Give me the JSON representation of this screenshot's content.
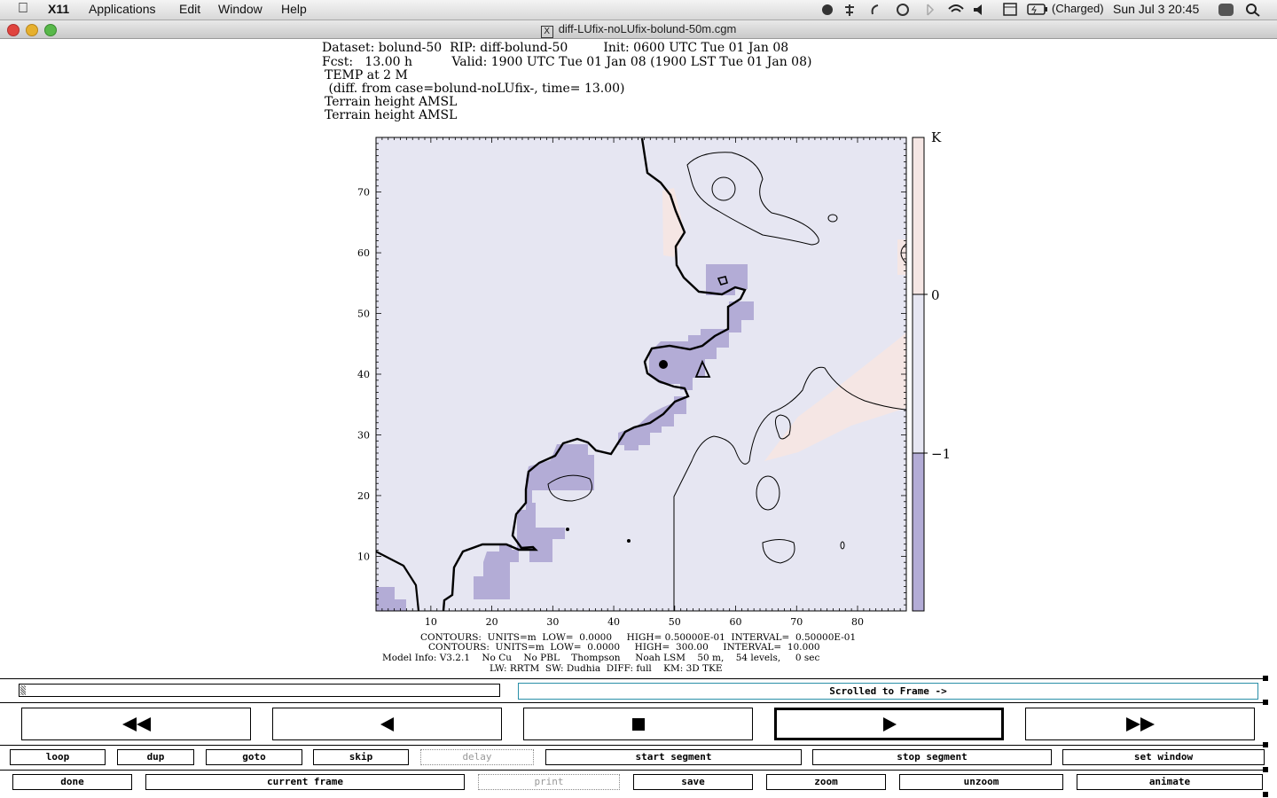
{
  "menubar": {
    "app": "X11",
    "items": [
      "Applications",
      "Edit",
      "Window",
      "Help"
    ],
    "battery": "(Charged)",
    "clock": "Sun Jul 3  20:45"
  },
  "window": {
    "title": "diff-LUfix-noLUfix-bolund-50m.cgm"
  },
  "header": {
    "line1": "Dataset: bolund-50  RIP: diff-bolund-50         Init: 0600 UTC Tue 01 Jan 08",
    "line2": "Fcst:   13.00 h          Valid: 1900 UTC Tue 01 Jan 08 (1900 LST Tue 01 Jan 08)",
    "line3": "TEMP at 2 M",
    "line4": " (diff. from case=bolund-noLUfix-, time= 13.00)",
    "line5": "Terrain height AMSL",
    "line6": "Terrain height AMSL"
  },
  "chart_data": {
    "type": "heatmap",
    "x_ticks": [
      10,
      20,
      30,
      40,
      50,
      60,
      70,
      80
    ],
    "y_ticks": [
      10,
      20,
      30,
      40,
      50,
      60,
      70
    ],
    "xlim": [
      1,
      88
    ],
    "ylim": [
      1,
      79
    ],
    "colorbar": {
      "unit": "K",
      "levels": [
        {
          "value": "0",
          "label": "0"
        },
        {
          "value": "-1",
          "label": "−1"
        }
      ],
      "colors": [
        "#f5e6e4",
        "#e6e6f2",
        "#b3acd6"
      ]
    }
  },
  "footer": {
    "line1": "CONTOURS:  UNITS=m  LOW=  0.0000     HIGH= 0.50000E-01  INTERVAL=  0.50000E-01",
    "line2": "CONTOURS:  UNITS=m  LOW=  0.0000     HIGH=  300.00     INTERVAL=  10.000",
    "line3": "Model Info: V3.2.1    No Cu    No PBL    Thompson     Noah LSM    50 m,    54 levels,     0 sec",
    "line4": "LW: RRTM  SW: Dudhia  DIFF: full    KM: 3D TKE"
  },
  "controls": {
    "status": "Scrolled to Frame ->",
    "row1": [
      "loop",
      "dup",
      "goto",
      "skip",
      "delay",
      "start segment",
      "stop segment",
      "set window"
    ],
    "row2": [
      "done",
      "current frame",
      "print",
      "save",
      "zoom",
      "unzoom",
      "animate"
    ]
  }
}
